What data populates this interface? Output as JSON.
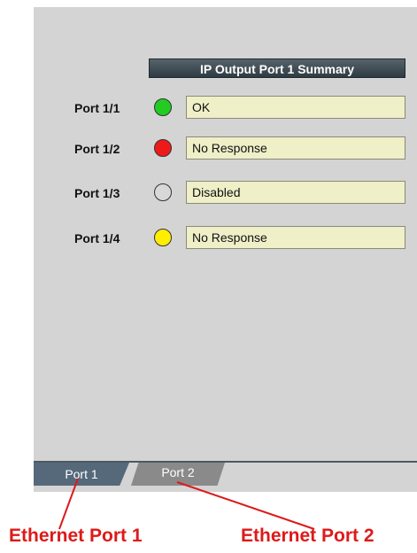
{
  "summary": {
    "title": "IP Output Port 1 Summary"
  },
  "ports": [
    {
      "label": "Port 1/1",
      "status": "OK",
      "led_color": "#22cc22"
    },
    {
      "label": "Port 1/2",
      "status": "No Response",
      "led_color": "#ee1a1a"
    },
    {
      "label": "Port 1/3",
      "status": "Disabled",
      "led_color": "#d8d8d8"
    },
    {
      "label": "Port 1/4",
      "status": "No Response",
      "led_color": "#ffee00"
    }
  ],
  "tabs": [
    {
      "label": "Port 1",
      "selected": true
    },
    {
      "label": "Port 2",
      "selected": false
    }
  ],
  "annotations": {
    "left": "Ethernet Port 1",
    "right": "Ethernet Port 2",
    "color": "#dd1a1a"
  }
}
